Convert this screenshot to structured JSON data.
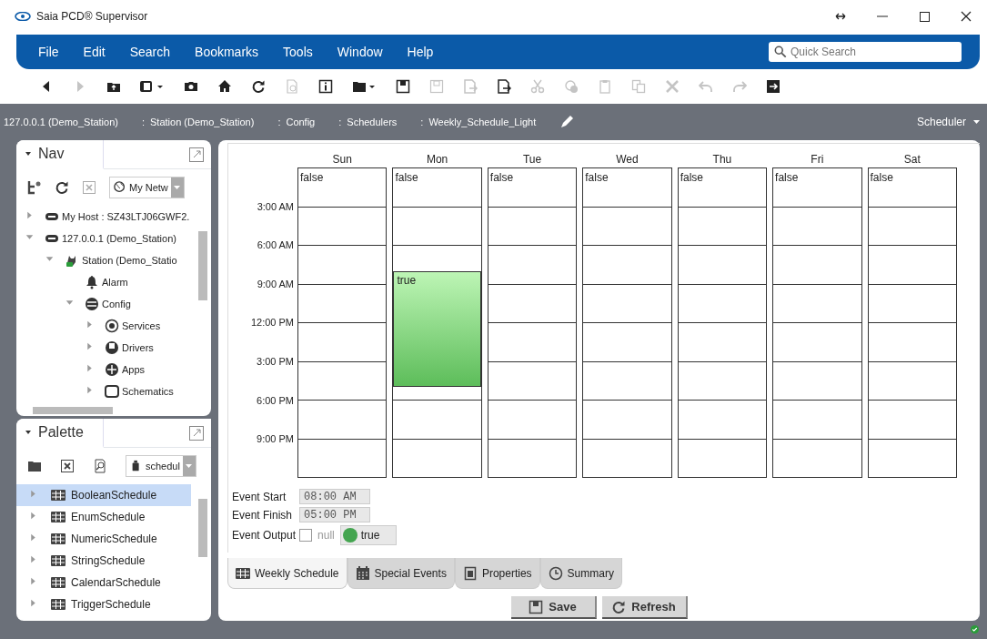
{
  "window": {
    "title": "Saia PCD® Supervisor"
  },
  "menu": [
    "File",
    "Edit",
    "Search",
    "Bookmarks",
    "Tools",
    "Window",
    "Help"
  ],
  "quick_search": {
    "placeholder": "Quick Search"
  },
  "toolbar": [
    {
      "kind": "back",
      "disabled": false
    },
    {
      "kind": "forward",
      "disabled": true
    },
    {
      "kind": "folder-up",
      "disabled": false
    },
    {
      "kind": "window-menu",
      "disabled": false
    },
    {
      "kind": "camera",
      "disabled": false
    },
    {
      "kind": "home",
      "disabled": false
    },
    {
      "kind": "refresh",
      "disabled": false
    },
    {
      "kind": "doc-refresh",
      "disabled": true
    },
    {
      "kind": "info",
      "disabled": false
    },
    {
      "kind": "folder-menu",
      "disabled": false
    },
    {
      "kind": "save",
      "disabled": false
    },
    {
      "kind": "save-all",
      "disabled": true
    },
    {
      "kind": "doc-arrow",
      "disabled": true
    },
    {
      "kind": "doc-arrow",
      "disabled": false
    },
    {
      "kind": "cut",
      "disabled": true
    },
    {
      "kind": "add",
      "disabled": true
    },
    {
      "kind": "paste",
      "disabled": true
    },
    {
      "kind": "copy",
      "disabled": true
    },
    {
      "kind": "delete",
      "disabled": true
    },
    {
      "kind": "undo",
      "disabled": true
    },
    {
      "kind": "redo",
      "disabled": true
    },
    {
      "kind": "exit",
      "disabled": false
    }
  ],
  "breadcrumb": [
    {
      "label": "127.0.0.1 (Demo_Station)"
    },
    {
      "separator": ":",
      "label": "Station (Demo_Station)"
    },
    {
      "separator": ":",
      "label": "Config"
    },
    {
      "separator": ":",
      "label": "Schedulers"
    },
    {
      "separator": ":",
      "label": "Weekly_Schedule_Light"
    }
  ],
  "view_selector": "Scheduler",
  "nav": {
    "title": "Nav",
    "dropdown": "My Netw",
    "tree": [
      {
        "label": "My Host : SZ43LTJ06GWF2.",
        "kind": "host",
        "expanded": false
      },
      {
        "label": "127.0.0.1 (Demo_Station)",
        "kind": "host",
        "expanded": true,
        "children": [
          {
            "label": "Station (Demo_Statio",
            "kind": "station",
            "expanded": true,
            "children": [
              {
                "label": "Alarm",
                "kind": "alarm"
              },
              {
                "label": "Config",
                "kind": "database",
                "expanded": true,
                "children": [
                  {
                    "label": "Services",
                    "kind": "services",
                    "expanded": false
                  },
                  {
                    "label": "Drivers",
                    "kind": "drivers",
                    "expanded": false
                  },
                  {
                    "label": "Apps",
                    "kind": "apps",
                    "expanded": false
                  },
                  {
                    "label": "Schematics",
                    "kind": "folder",
                    "expanded": false
                  }
                ]
              }
            ]
          }
        ]
      }
    ]
  },
  "palette": {
    "title": "Palette",
    "dropdown": "schedul",
    "items": [
      {
        "label": "BooleanSchedule",
        "selected": true
      },
      {
        "label": "EnumSchedule",
        "selected": false
      },
      {
        "label": "NumericSchedule",
        "selected": false
      },
      {
        "label": "StringSchedule",
        "selected": false
      },
      {
        "label": "CalendarSchedule",
        "selected": false
      },
      {
        "label": "TriggerSchedule",
        "selected": false
      }
    ]
  },
  "schedule": {
    "times": [
      "3:00 AM",
      "6:00 AM",
      "9:00 AM",
      "12:00 PM",
      "3:00 PM",
      "6:00 PM",
      "9:00 PM"
    ],
    "days": [
      {
        "name": "Sun",
        "default": "false"
      },
      {
        "name": "Mon",
        "default": "false",
        "events": [
          {
            "value": "true",
            "selected": true
          }
        ]
      },
      {
        "name": "Tue",
        "default": "false"
      },
      {
        "name": "Wed",
        "default": "false"
      },
      {
        "name": "Thu",
        "default": "false"
      },
      {
        "name": "Fri",
        "default": "false"
      },
      {
        "name": "Sat",
        "default": "false"
      }
    ]
  },
  "event_editor": {
    "start_label": "Event Start",
    "start": "08:00 AM",
    "finish_label": "Event Finish",
    "finish": "05:00 PM",
    "output_label": "Event Output",
    "null_checked": false,
    "null_label": "null",
    "output": "true"
  },
  "tabs": [
    {
      "label": "Weekly Schedule",
      "kind": "grid",
      "selected": true
    },
    {
      "label": "Special Events",
      "kind": "calendar",
      "selected": false
    },
    {
      "label": "Properties",
      "kind": "doc",
      "selected": false
    },
    {
      "label": "Summary",
      "kind": "clock",
      "selected": false
    }
  ],
  "buttons": [
    {
      "label": "Save",
      "kind": "save"
    },
    {
      "label": "Refresh",
      "kind": "refresh"
    }
  ]
}
